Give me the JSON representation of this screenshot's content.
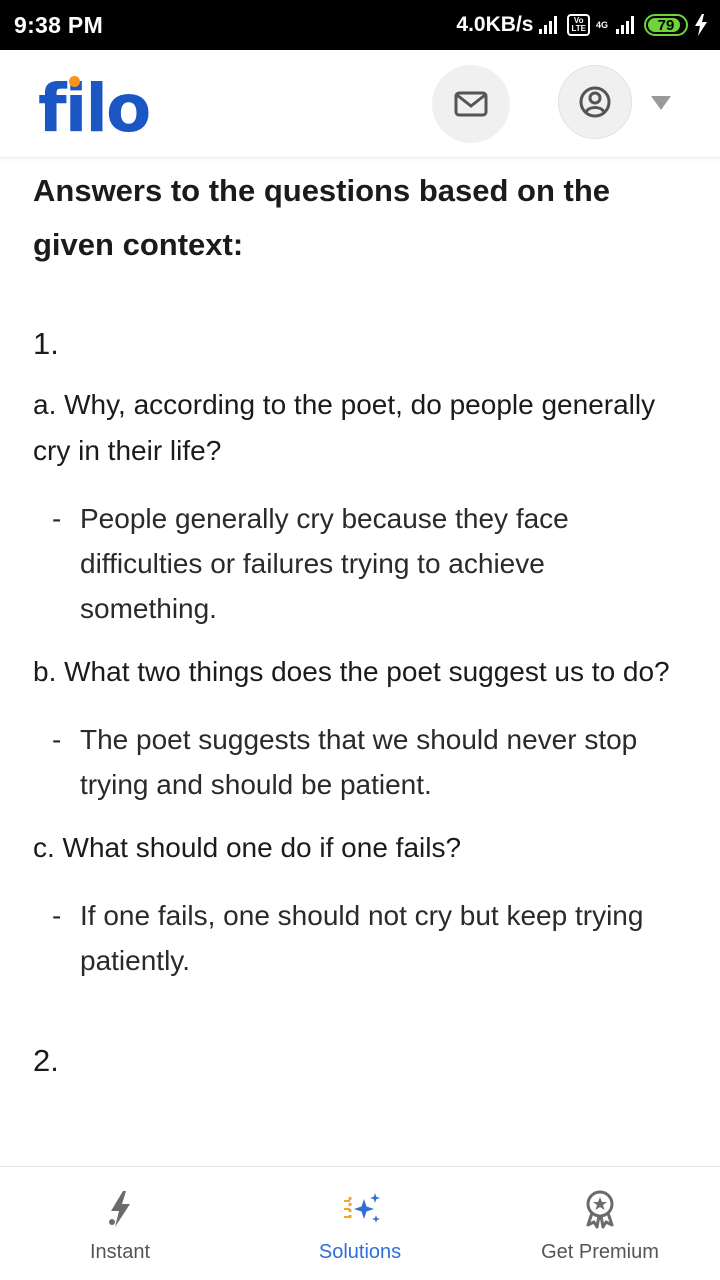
{
  "status_bar": {
    "time": "9:38 PM",
    "speed": "4.0KB/s",
    "lte_top": "Vo",
    "lte_bottom": "LTE",
    "network_type": "4G",
    "battery": "79"
  },
  "header": {
    "logo": "filo",
    "icons": [
      "mail-icon",
      "profile-icon",
      "chevron-down-icon"
    ]
  },
  "content": {
    "title": "Answers to the questions based on the given context:",
    "sections": [
      {
        "number": "1.",
        "items": [
          {
            "question": "a. Why, according to the poet, do people generally cry in their life?",
            "answer": "People generally cry because they face difficulties or failures trying to achieve something."
          },
          {
            "question": "b. What two things does the poet suggest us to do?",
            "answer": "The poet suggests that we should never stop trying and should be patient."
          },
          {
            "question": "c. What should one do if one fails?",
            "answer": "If one fails, one should not cry but keep trying patiently."
          }
        ]
      },
      {
        "number": "2."
      }
    ]
  },
  "bottom_nav": [
    {
      "label": "Instant",
      "icon": "lightning-icon",
      "active": false
    },
    {
      "label": "Solutions",
      "icon": "sparkle-icon",
      "active": true
    },
    {
      "label": "Get Premium",
      "icon": "award-icon",
      "active": false
    }
  ],
  "colors": {
    "brand_blue": "#1a56c4",
    "logo_dot": "#f7931e",
    "active_nav": "#2f6fd6",
    "battery": "#6fd33a"
  }
}
